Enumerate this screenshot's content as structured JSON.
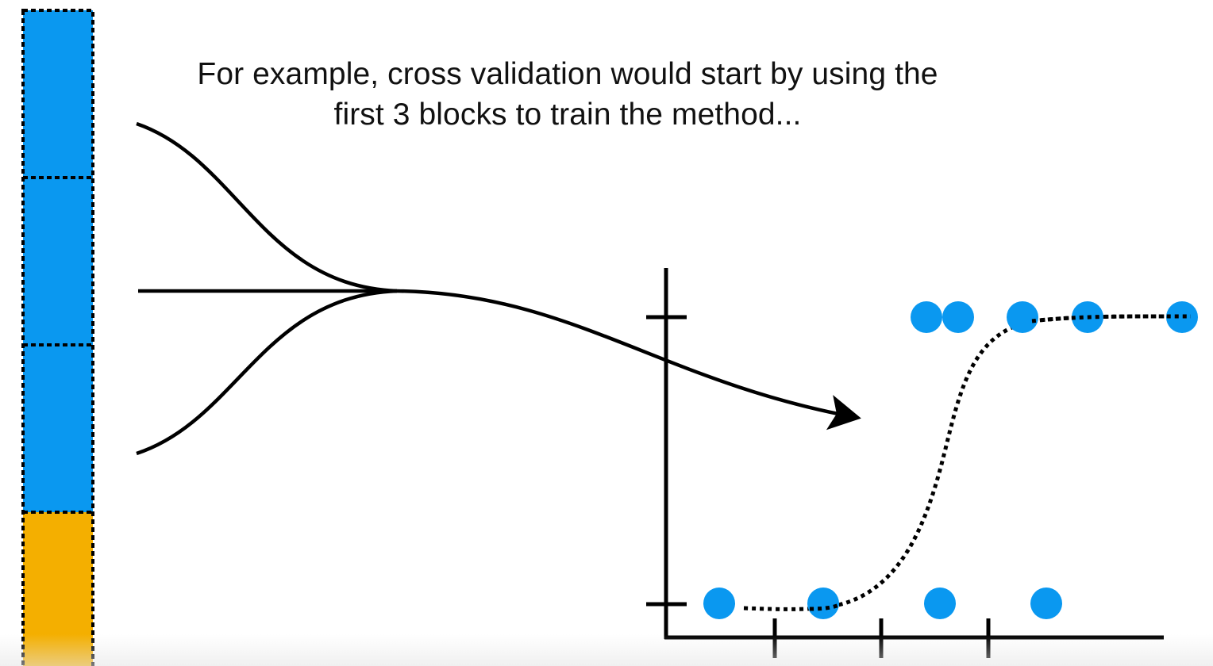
{
  "caption": {
    "line1": "For example, cross validation would start by using the",
    "line2": "first 3 blocks to train the method..."
  },
  "colors": {
    "training_block": "#0a98f0",
    "testing_block": "#f4af00",
    "data_point": "#0a98f0",
    "ink": "#000000"
  },
  "blocks": [
    {
      "role": "training",
      "color": "#0a98f0"
    },
    {
      "role": "training",
      "color": "#0a98f0"
    },
    {
      "role": "training",
      "color": "#0a98f0"
    },
    {
      "role": "testing",
      "color": "#f4af00"
    }
  ],
  "plot": {
    "curve": "logistic-s-curve-dotted",
    "y_ticks": 2,
    "x_ticks": 3,
    "points": [
      {
        "x": 1.0,
        "y": 0
      },
      {
        "x": 2.0,
        "y": 0
      },
      {
        "x": 3.1,
        "y": 0
      },
      {
        "x": 4.1,
        "y": 0
      },
      {
        "x": 3.0,
        "y": 1
      },
      {
        "x": 3.3,
        "y": 1
      },
      {
        "x": 3.9,
        "y": 1
      },
      {
        "x": 4.5,
        "y": 1
      },
      {
        "x": 5.4,
        "y": 1
      }
    ]
  }
}
